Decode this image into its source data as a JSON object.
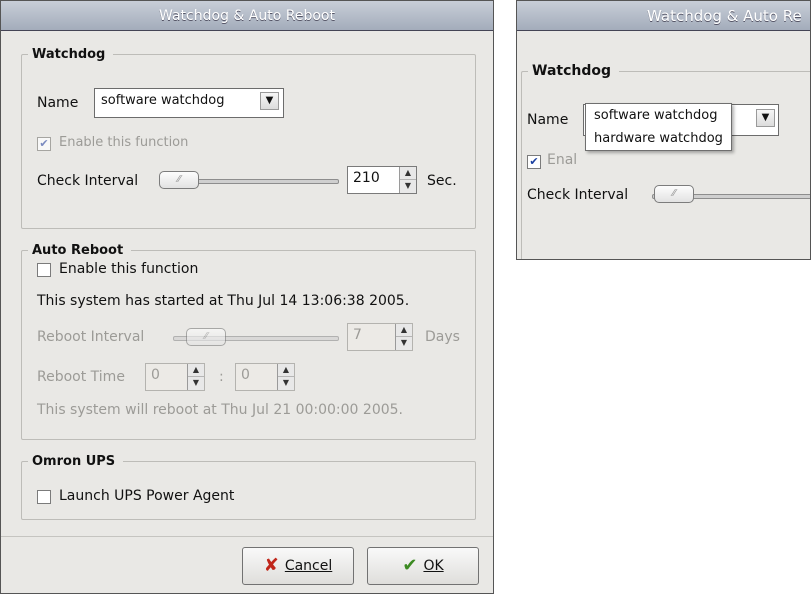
{
  "dialog": {
    "title": "Watchdog & Auto Reboot",
    "watchdog": {
      "legend": "Watchdog",
      "name_label": "Name",
      "name_value": "software watchdog",
      "enable_label": "Enable this function",
      "enable_checked": true,
      "check_interval_label": "Check Interval",
      "check_interval_value": "210",
      "check_interval_unit": "Sec."
    },
    "auto_reboot": {
      "legend": "Auto Reboot",
      "enable_label": "Enable this function",
      "enable_checked": false,
      "started_text": "This system has started at Thu Jul 14 13:06:38 2005.",
      "reboot_interval_label": "Reboot Interval",
      "reboot_interval_value": "7",
      "reboot_interval_unit": "Days",
      "reboot_time_label": "Reboot Time",
      "reboot_time_hour": "0",
      "reboot_time_sep": ":",
      "reboot_time_minute": "0",
      "will_reboot_text": "This system will reboot at Thu Jul 21 00:00:00 2005."
    },
    "omron_ups": {
      "legend": "Omron UPS",
      "launch_label": "Launch UPS Power Agent",
      "launch_checked": false
    },
    "buttons": {
      "cancel_label": "Cancel",
      "ok_label": "OK"
    }
  },
  "inset": {
    "title": "Watchdog & Auto Re",
    "legend": "Watchdog",
    "name_label": "Name",
    "enable_label_partial": "Enal",
    "check_interval_label": "Check Interval",
    "dropdown_options": [
      "software watchdog",
      "hardware watchdog"
    ]
  },
  "icons": {
    "checked": "check-mark",
    "cancel": "red-x-icon",
    "ok": "green-checkmark-icon",
    "combo_arrow": "chevron-down-icon",
    "spin_up": "spin-up-icon",
    "spin_down": "spin-down-icon"
  },
  "colors": {
    "title_bar": "#a3acbb",
    "window_bg": "#e9e8e5",
    "cancel_icon": "#c0261a",
    "ok_icon": "#3c8a22"
  }
}
